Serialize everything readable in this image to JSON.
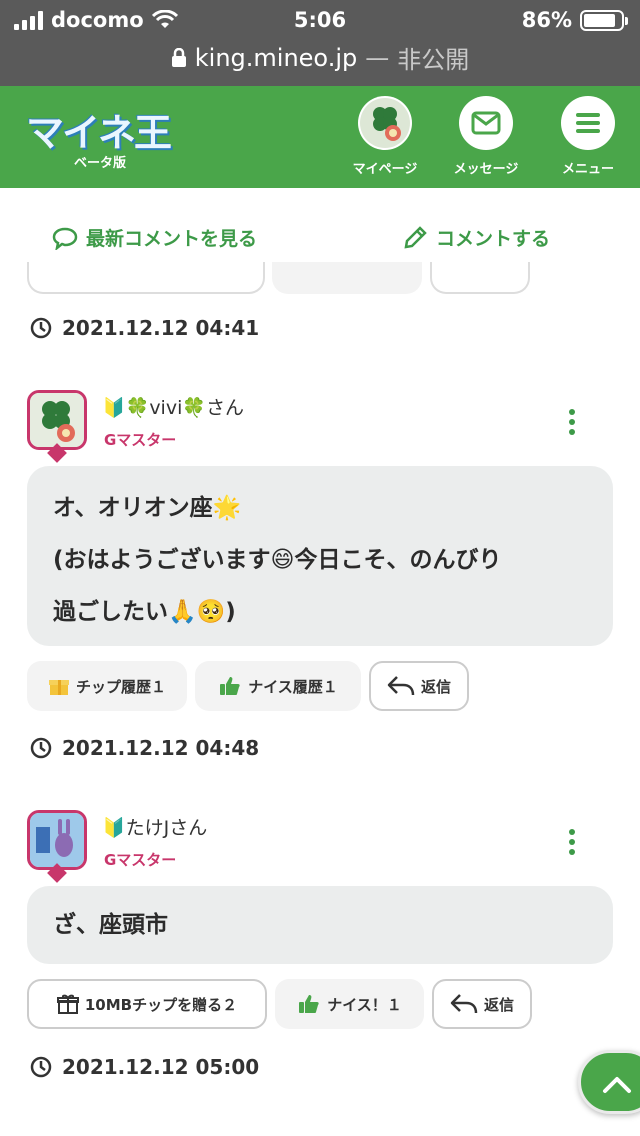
{
  "status_bar": {
    "carrier": "docomo",
    "time": "5:06",
    "battery": "86%",
    "battery_level": 0.86
  },
  "url_bar": {
    "domain": "king.mineo.jp",
    "separator": "—",
    "privacy": "非公開"
  },
  "header": {
    "logo_text": "マイネ王",
    "logo_sub": "ベータ版",
    "nav": [
      {
        "label": "マイページ",
        "icon": "avatar-icon"
      },
      {
        "label": "メッセージ",
        "icon": "mail-icon"
      },
      {
        "label": "メニュー",
        "icon": "hamburger-menu-icon"
      }
    ],
    "accent": "#4aa64a"
  },
  "actions": {
    "latest_comments": "最新コメントを見る",
    "write_comment": "コメントする"
  },
  "timestamps": {
    "t0": "2021.12.12 04:41"
  },
  "comments": [
    {
      "user": "🔰🍀vivi🍀さん",
      "rank": "Gマスター",
      "body_lines": [
        "オ、オリオン座🌟",
        "(おはようございます😄今日こそ、のんびり",
        "過ごしたい🙏🥺)"
      ],
      "buttons": {
        "tip": "チップ履歴１",
        "nice": "ナイス履歴１",
        "reply": "返信"
      },
      "timestamp": "2021.12.12 04:48"
    },
    {
      "user": "🔰たけJさん",
      "rank": "Gマスター",
      "body_lines": [
        "ざ、座頭市"
      ],
      "buttons": {
        "tip": "10MBチップを贈る２",
        "nice": "ナイス！１",
        "reply": "返信"
      },
      "timestamp": "2021.12.12 05:00"
    }
  ],
  "colors": {
    "brand_green": "#4aa64a",
    "rank_pink": "#c8366b",
    "bubble_bg": "#ebeded"
  }
}
